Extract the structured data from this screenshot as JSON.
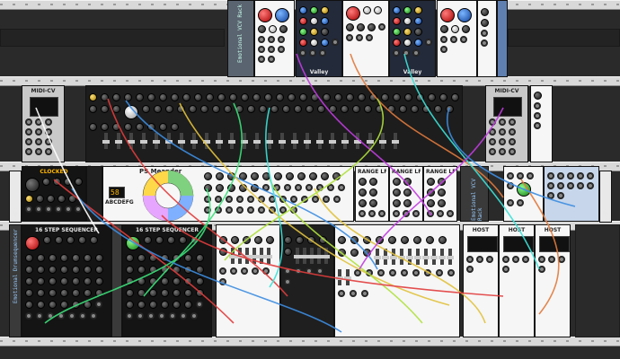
{
  "modules": {
    "valley_left": "Valley",
    "valley_right": "Valley",
    "midi_left": "MIDI-CV",
    "midi_right": "MIDI-CV",
    "clocked": "CLOCKED",
    "meander": "PS Meander",
    "meander_step": "58",
    "meander_mode": "ABCDEFG",
    "range_lfo_1": "RANGE LFO",
    "range_lfo_2": "RANGE LFO",
    "range_lfo_3": "RANGE LFO",
    "seq_left": "16 STEP SEQUENCER",
    "seq_right": "16 STEP SEQUENCER",
    "host_1": "HOST",
    "host_2": "HOST",
    "host_3": "HOST",
    "vcv_text_top": "Emotional VCV Rack",
    "vcv_text_right": "Emotional VCV Rack",
    "vcv_text_left": "Emotional Drumsequencer",
    "fp_left": "fp",
    "fp_right": "fp"
  },
  "colors": {
    "cable_palette": [
      "#e23c3c",
      "#3c8de2",
      "#e2c23c",
      "#3ce27a",
      "#c23ce2",
      "#e27a3c",
      "#3ce2d8",
      "#b0e23c",
      "#ffffff"
    ]
  }
}
